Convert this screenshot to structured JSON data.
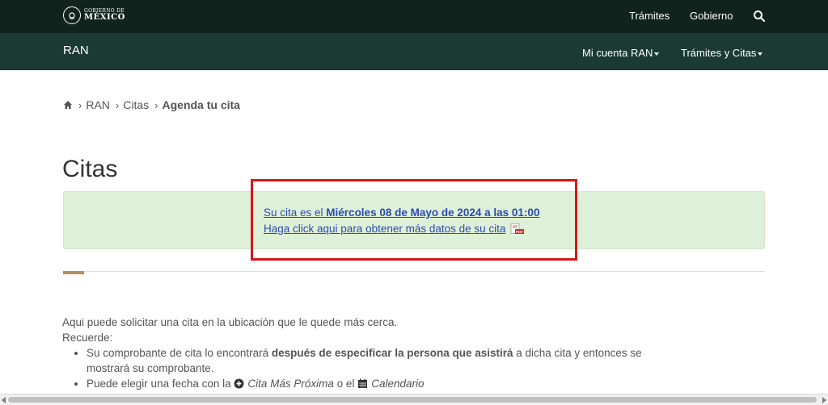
{
  "header": {
    "logo_line1": "GOBIERNO DE",
    "logo_line2": "MÉXICO",
    "links": [
      "Trámites",
      "Gobierno"
    ],
    "search_icon": "search-icon"
  },
  "subheader": {
    "title": "RAN",
    "menus": [
      "Mi cuenta RAN",
      "Trámites y Citas"
    ]
  },
  "breadcrumb": {
    "items": [
      "RAN",
      "Citas",
      "Agenda tu cita"
    ]
  },
  "page": {
    "title": "Citas"
  },
  "alert": {
    "line1_prefix": "Su cita es el ",
    "line1_date": "Miércoles 08 de Mayo de 2024 a las 01:00",
    "line2": "Haga click aqui para obtener más datos de su cita",
    "pdf_label": "PDF"
  },
  "content": {
    "intro": "Aqui puede solicitar una cita en la ubicación que le quede más cerca.",
    "reminder": "Recuerde:",
    "bullet1_a": "Su comprobante de cita lo encontrará ",
    "bullet1_b": "después de especificar la persona que asistirá",
    "bullet1_c": " a dicha cita y entonces se mostrará su comprobante.",
    "bullet2_a": "Puede elegir una fecha con la ",
    "bullet2_b": "Cita Más Próxima",
    "bullet2_c": " o el ",
    "bullet2_d": "Calendario"
  },
  "colors": {
    "topbar": "#10241d",
    "subbar": "#1b3a32",
    "alert_bg": "#dff0d8",
    "link": "#2b4bb5",
    "highlight": "#d11919",
    "accent": "#b38e5d"
  }
}
